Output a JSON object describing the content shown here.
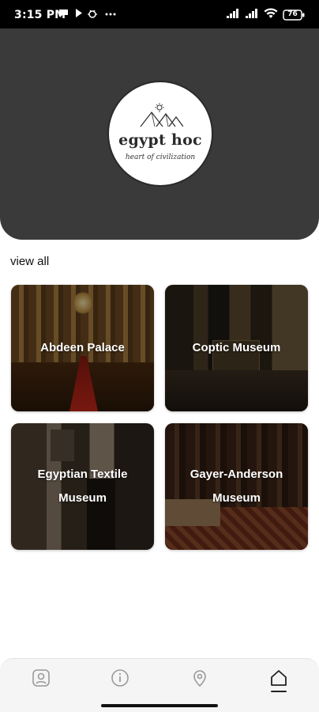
{
  "status_bar": {
    "time": "3:15 PM",
    "battery": "76",
    "icons": [
      "chat-bubble-icon",
      "play-icon",
      "bug-icon",
      "more-dots-icon",
      "signal-icon",
      "signal-icon",
      "wifi-icon",
      "battery-icon"
    ]
  },
  "header": {
    "logo": {
      "title": "egypt hoc",
      "subtitle": "heart of civilization",
      "icon": "pyramids-sun-icon"
    },
    "background_color": "#3a3a3a"
  },
  "section": {
    "view_all_label": "view all"
  },
  "places": [
    {
      "name": "Abdeen Palace"
    },
    {
      "name": "Coptic Museum"
    },
    {
      "name": "Egyptian Textile Museum"
    },
    {
      "name": "Gayer-Anderson Museum"
    }
  ],
  "bottom_nav": {
    "items": [
      {
        "icon": "profile-icon",
        "active": false
      },
      {
        "icon": "info-icon",
        "active": false
      },
      {
        "icon": "location-icon",
        "active": false
      },
      {
        "icon": "home-icon",
        "active": true
      }
    ]
  }
}
